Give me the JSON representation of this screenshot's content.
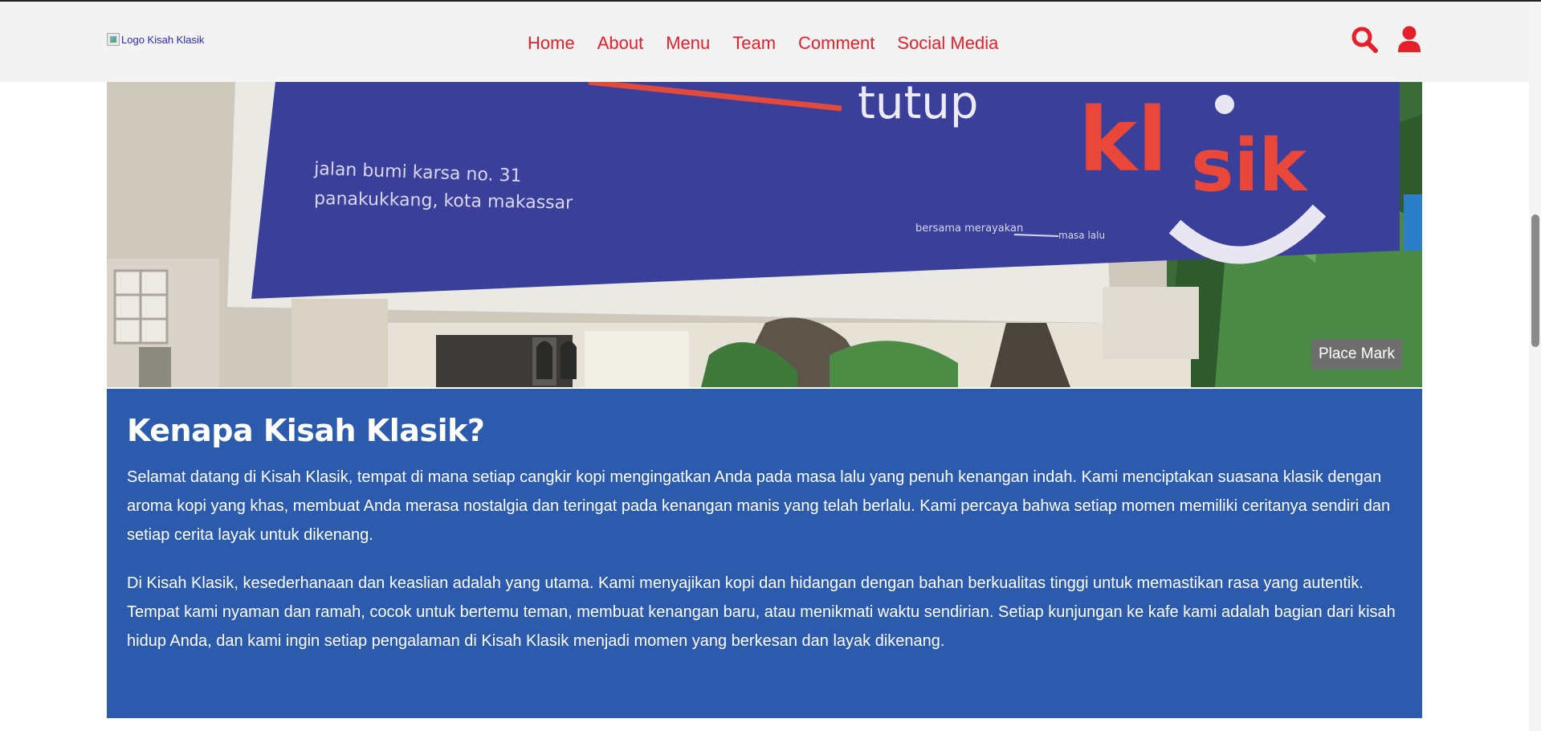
{
  "header": {
    "logo_alt": "Logo Kisah Klasik",
    "nav": [
      "Home",
      "About",
      "Menu",
      "Team",
      "Comment",
      "Social Media"
    ],
    "icons": [
      "search-icon",
      "user-icon"
    ]
  },
  "hero": {
    "sign_text_main": "tutup",
    "sign_address_line1": "jalan bumi karsa no. 31",
    "sign_address_line2": "panakukkang, kota makassar",
    "sign_tagline_left": "bersama merayakan",
    "sign_tagline_right": "masa lalu",
    "sign_logo_top": "kl",
    "sign_logo_bottom": "sik",
    "place_mark": "Place Mark"
  },
  "about": {
    "title": "Kenapa Kisah Klasik?",
    "paragraphs": [
      "Selamat datang di Kisah Klasik, tempat di mana setiap cangkir kopi mengingatkan Anda pada masa lalu yang penuh kenangan indah. Kami menciptakan suasana klasik dengan aroma kopi yang khas, membuat Anda merasa nostalgia dan teringat pada kenangan manis yang telah berlalu. Kami percaya bahwa setiap momen memiliki ceritanya sendiri dan setiap cerita layak untuk dikenang.",
      "Di Kisah Klasik, kesederhanaan dan keaslian adalah yang utama. Kami menyajikan kopi dan hidangan dengan bahan berkualitas tinggi untuk memastikan rasa yang autentik. Tempat kami nyaman dan ramah, cocok untuk bertemu teman, membuat kenangan baru, atau menikmati waktu sendirian. Setiap kunjungan ke kafe kami adalah bagian dari kisah hidup Anda, dan kami ingin setiap pengalaman di Kisah Klasik menjadi momen yang berkesan dan layak dikenang."
    ]
  },
  "colors": {
    "accent": "#e5202a",
    "about_bg": "#2c5aad",
    "header_bg": "#f3f3f3",
    "sign_blue": "#3a3f9a"
  }
}
